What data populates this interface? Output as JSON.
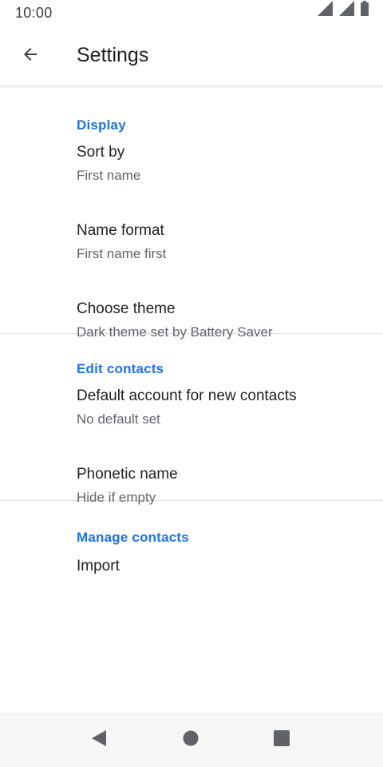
{
  "status_bar": {
    "time": "10:00",
    "icons": [
      "signal-icon",
      "signal-icon",
      "battery-icon"
    ]
  },
  "app_bar": {
    "title": "Settings",
    "back_icon": "arrow-back-icon"
  },
  "colors": {
    "accent": "#1a73e8",
    "primary_text": "#202124",
    "secondary_text": "#5f6368",
    "divider": "#dadce0",
    "nav_bar_bg": "#f6f6f6"
  },
  "sections": [
    {
      "title": "Display",
      "items": [
        {
          "title": "Sort by",
          "summary": "First name"
        },
        {
          "title": "Name format",
          "summary": "First name first"
        },
        {
          "title": "Choose theme",
          "summary": "Dark theme set by Battery Saver"
        }
      ]
    },
    {
      "title": "Edit contacts",
      "items": [
        {
          "title": "Default account for new contacts",
          "summary": "No default set"
        },
        {
          "title": "Phonetic name",
          "summary": "Hide if empty"
        }
      ]
    },
    {
      "title": "Manage contacts",
      "items": [
        {
          "title": "Import",
          "summary": ""
        }
      ]
    }
  ],
  "nav_bar": {
    "icons": [
      "back-triangle-icon",
      "home-circle-icon",
      "recents-square-icon"
    ]
  }
}
